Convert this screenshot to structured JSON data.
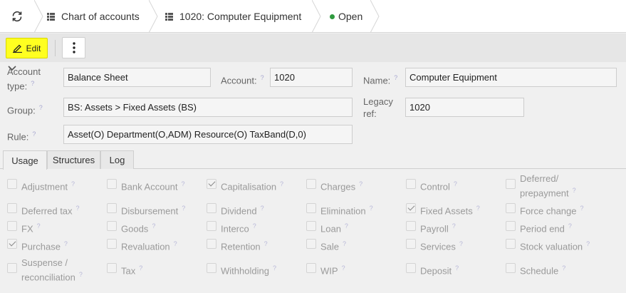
{
  "breadcrumb": {
    "items": [
      {
        "label": "Chart of accounts"
      },
      {
        "label": "1020: Computer Equipment"
      },
      {
        "label": "Open"
      }
    ]
  },
  "toolbar": {
    "edit_label": "Edit"
  },
  "form": {
    "account_type_label": "Account type:",
    "account_type_value": "Balance Sheet",
    "account_label": "Account:",
    "account_value": "1020",
    "name_label": "Name:",
    "name_value": "Computer Equipment",
    "group_label": "Group:",
    "group_value": "BS: Assets > Fixed Assets (BS)",
    "legacy_label": "Legacy ref:",
    "legacy_value": "1020",
    "rule_label": "Rule:",
    "rule_value": "Asset(O) Department(O,ADM) Resource(O) TaxBand(D,0)",
    "help_mark": "?"
  },
  "tabs": [
    {
      "label": "Usage",
      "active": true
    },
    {
      "label": "Structures",
      "active": false
    },
    {
      "label": "Log",
      "active": false
    }
  ],
  "usage": [
    {
      "label": "Adjustment",
      "checked": false
    },
    {
      "label": "Bank Account",
      "checked": false
    },
    {
      "label": "Capitalisation",
      "checked": true
    },
    {
      "label": "Charges",
      "checked": false
    },
    {
      "label": "Control",
      "checked": false
    },
    {
      "label": "Deferred/ prepayment",
      "checked": false
    },
    {
      "label": "Deferred tax",
      "checked": false
    },
    {
      "label": "Disbursement",
      "checked": false
    },
    {
      "label": "Dividend",
      "checked": false
    },
    {
      "label": "Elimination",
      "checked": false
    },
    {
      "label": "Fixed Assets",
      "checked": true
    },
    {
      "label": "Force change",
      "checked": false
    },
    {
      "label": "FX",
      "checked": false
    },
    {
      "label": "Goods",
      "checked": false
    },
    {
      "label": "Interco",
      "checked": false
    },
    {
      "label": "Loan",
      "checked": false
    },
    {
      "label": "Payroll",
      "checked": false
    },
    {
      "label": "Period end",
      "checked": false
    },
    {
      "label": "Purchase",
      "checked": true
    },
    {
      "label": "Revaluation",
      "checked": false
    },
    {
      "label": "Retention",
      "checked": false
    },
    {
      "label": "Sale",
      "checked": false
    },
    {
      "label": "Services",
      "checked": false
    },
    {
      "label": "Stock valuation",
      "checked": false
    },
    {
      "label": "Suspense / reconciliation",
      "checked": false
    },
    {
      "label": "Tax",
      "checked": false
    },
    {
      "label": "Withholding",
      "checked": false
    },
    {
      "label": "WIP",
      "checked": false
    },
    {
      "label": "Deposit",
      "checked": false
    },
    {
      "label": "Schedule",
      "checked": false
    }
  ],
  "colors": {
    "edit_button": "#ffff20",
    "status_dot": "#2e9a3e"
  }
}
